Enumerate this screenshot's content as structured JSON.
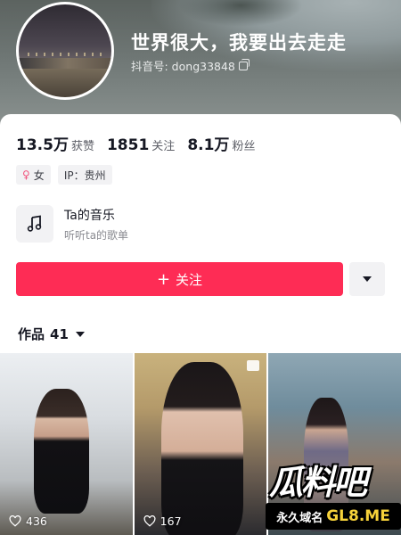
{
  "profile": {
    "nickname": "世界很大，我要出去走走",
    "douyin_id_label": "抖音号: dong33848"
  },
  "stats": [
    {
      "value": "13.5万",
      "label": "获赞"
    },
    {
      "value": "1851",
      "label": "关注"
    },
    {
      "value": "8.1万",
      "label": "粉丝"
    }
  ],
  "tags": {
    "gender_icon": "female-icon",
    "gender": "女",
    "ip": "IP：贵州"
  },
  "music": {
    "icon": "music-note-icon",
    "title": "Ta的音乐",
    "subtitle": "听听ta的歌单"
  },
  "actions": {
    "follow_label": "关注",
    "follow_icon": "plus-icon",
    "more_icon": "triangle-down-icon",
    "accent_color": "#fe2c55"
  },
  "works": {
    "label": "作品",
    "count": "41"
  },
  "videos": [
    {
      "likes": "436"
    },
    {
      "likes": "167"
    },
    {
      "likes": ""
    }
  ],
  "watermark": {
    "logo_text": "瓜料吧",
    "domain_cn": "永久域名",
    "domain_en": "GL8.ME"
  }
}
